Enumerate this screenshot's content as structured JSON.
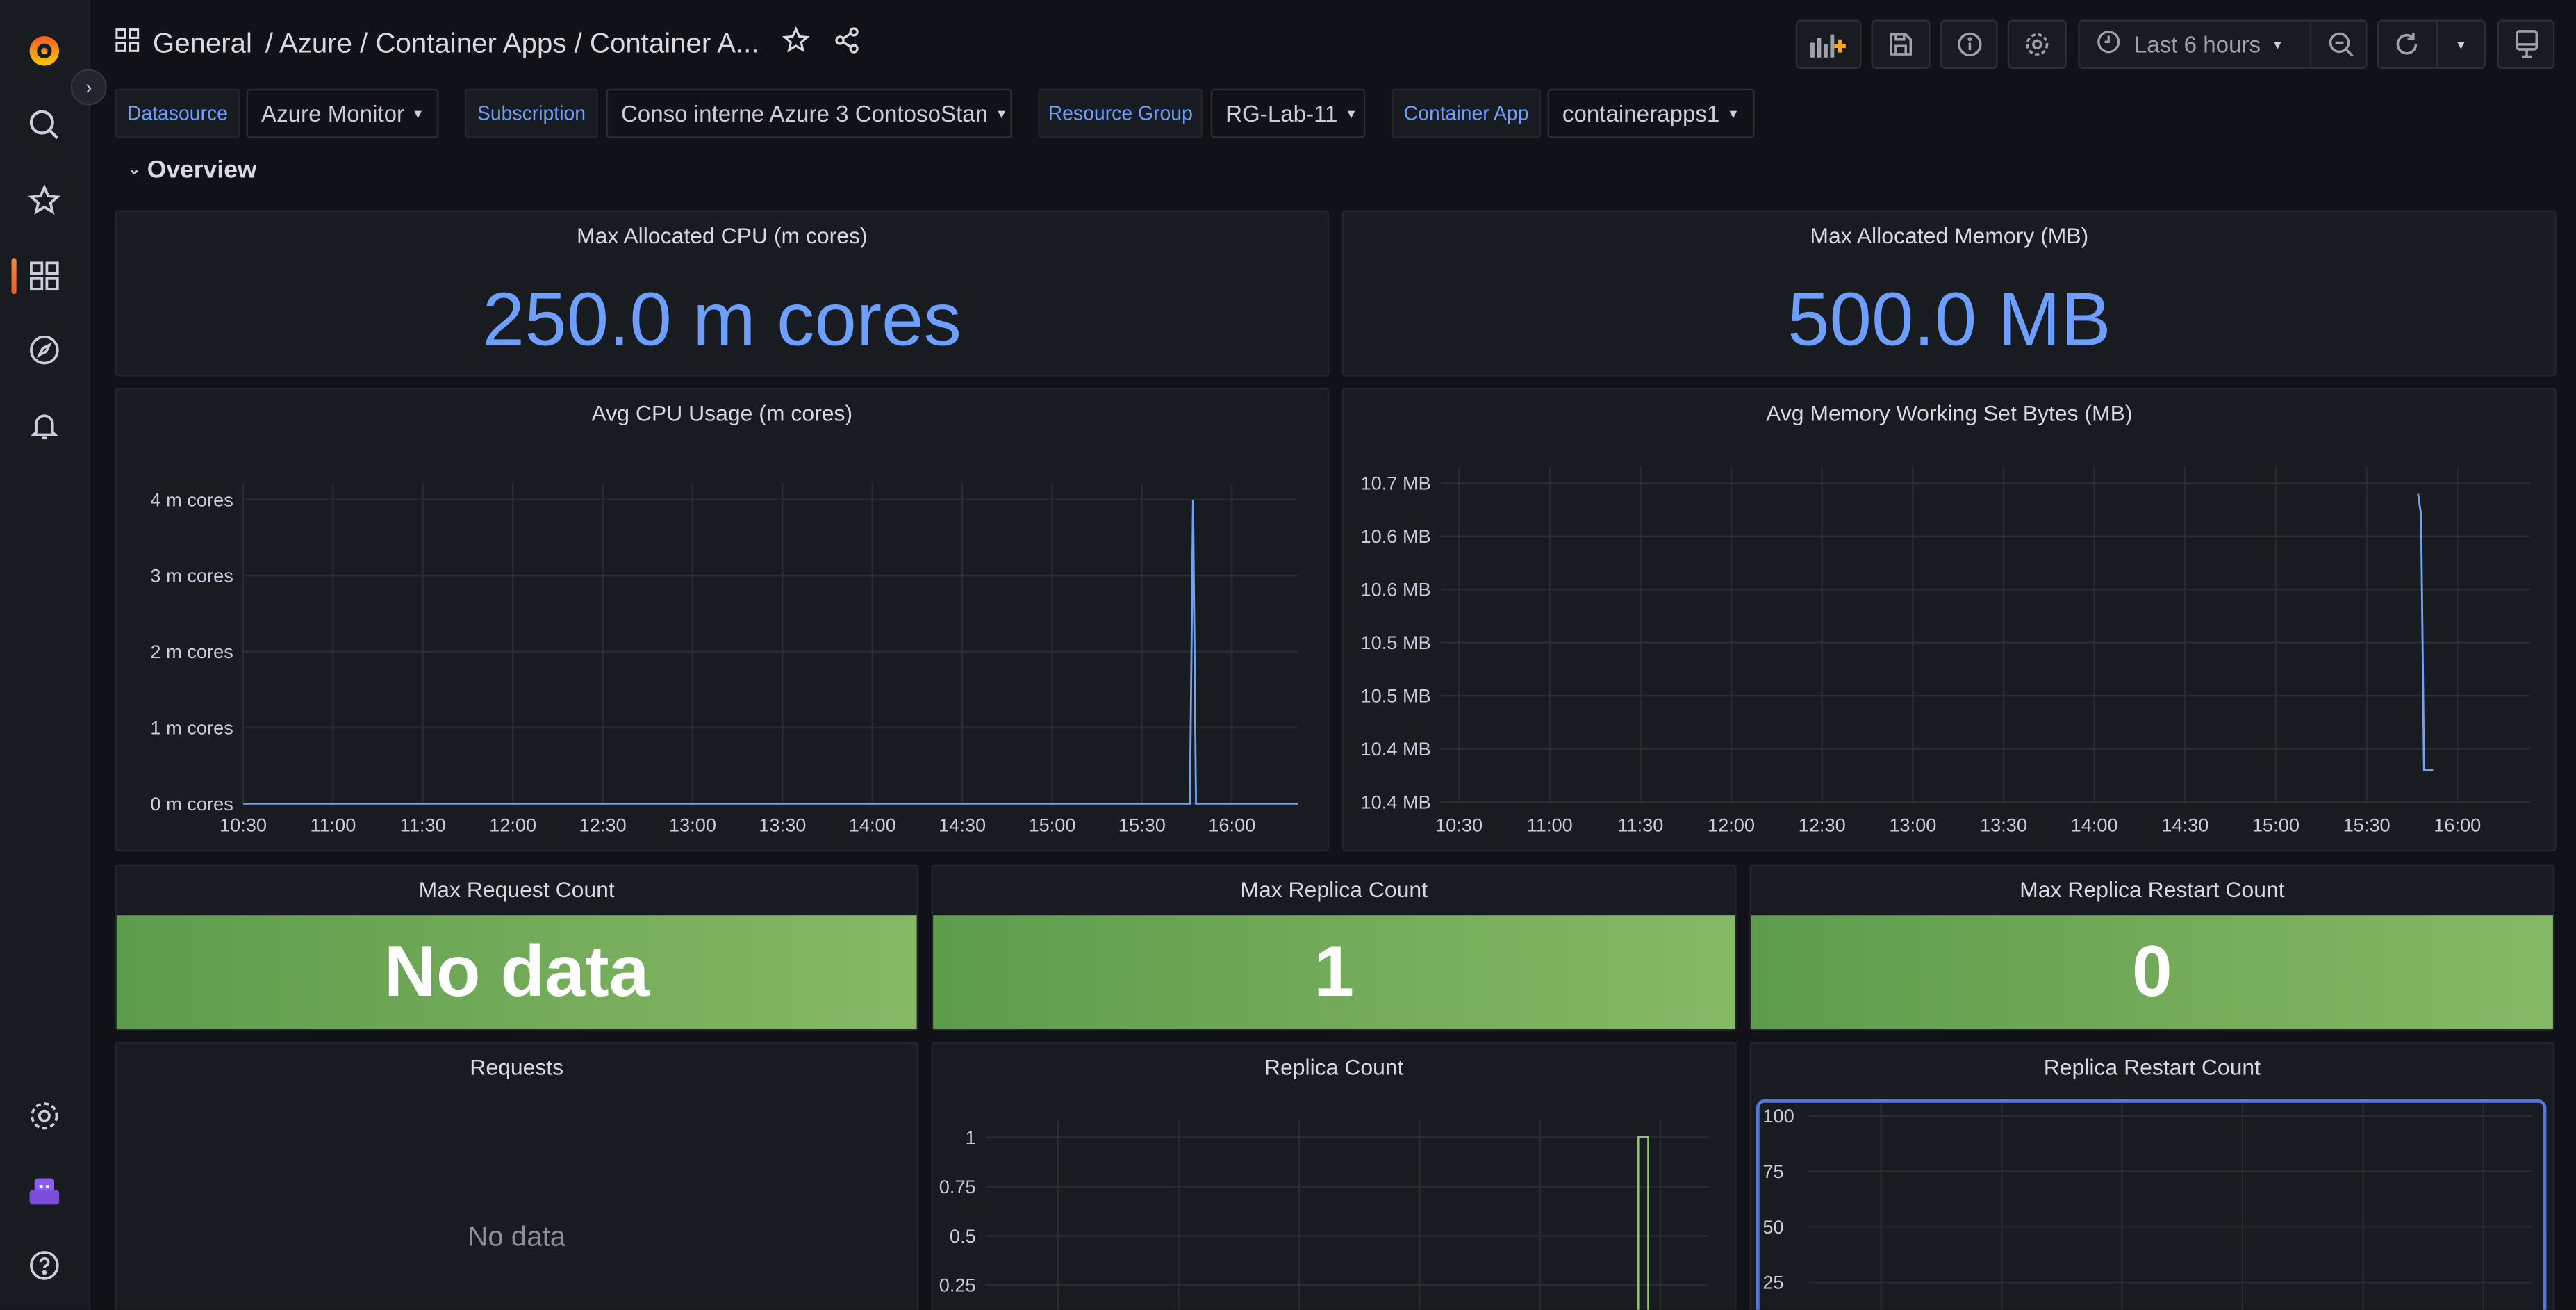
{
  "breadcrumb": {
    "root": "General",
    "path": "/ Azure / Container Apps / Container A..."
  },
  "toolbar": {
    "time_range": "Last 6 hours"
  },
  "variables": [
    {
      "label": "Datasource",
      "value": "Azure Monitor"
    },
    {
      "label": "Subscription",
      "value": "Conso interne Azure 3 ContosoStan"
    },
    {
      "label": "Resource Group",
      "value": "RG-Lab-11"
    },
    {
      "label": "Container App",
      "value": "containerapps1"
    }
  ],
  "row": {
    "title": "Overview"
  },
  "panels": {
    "max_cpu": {
      "title": "Max Allocated CPU (m cores)",
      "value": "250.0 m cores"
    },
    "max_mem": {
      "title": "Max Allocated Memory (MB)",
      "value": "500.0 MB"
    },
    "avg_cpu": {
      "title": "Avg CPU Usage (m cores)"
    },
    "avg_mem": {
      "title": "Avg Memory Working Set Bytes (MB)"
    },
    "max_requests": {
      "title": "Max Request Count",
      "value": "No data"
    },
    "max_replicas": {
      "title": "Max Replica Count",
      "value": "1"
    },
    "max_restarts": {
      "title": "Max Replica Restart Count",
      "value": "0"
    },
    "requests": {
      "title": "Requests",
      "value": "No data"
    },
    "replica_count": {
      "title": "Replica Count"
    },
    "replica_restart": {
      "title": "Replica Restart Count"
    }
  },
  "colors": {
    "accent": "#6e9fff",
    "stat_green": "#73b25a",
    "line_blue": "#73a1f2",
    "line_green": "#8ac766",
    "selected": "#5577dd"
  },
  "chart_data": [
    {
      "id": "avg_cpu",
      "type": "line",
      "title": "Avg CPU Usage (m cores)",
      "x_range": [
        "10:30",
        "16:22"
      ],
      "ylim": [
        0,
        4
      ],
      "x_ticks": [
        "10:30",
        "11:00",
        "11:30",
        "12:00",
        "12:30",
        "13:00",
        "13:30",
        "14:00",
        "14:30",
        "15:00",
        "15:30",
        "16:00"
      ],
      "y_ticks": [
        {
          "v": 0,
          "label": "0 m cores"
        },
        {
          "v": 1,
          "label": "1 m cores"
        },
        {
          "v": 2,
          "label": "2 m cores"
        },
        {
          "v": 3,
          "label": "3 m cores"
        },
        {
          "v": 4,
          "label": "4 m cores"
        }
      ],
      "series": [
        {
          "name": "Avg CPU",
          "color": "#73a1f2",
          "points": [
            [
              "10:30",
              0
            ],
            [
              "15:46",
              0
            ],
            [
              "15:47",
              4
            ],
            [
              "15:48",
              0
            ],
            [
              "16:22",
              0
            ]
          ]
        }
      ]
    },
    {
      "id": "avg_mem",
      "type": "line",
      "title": "Avg Memory Working Set Bytes (MB)",
      "x_range": [
        "10:24",
        "16:24"
      ],
      "ylim": [
        10.4,
        10.7
      ],
      "x_ticks": [
        "10:30",
        "11:00",
        "11:30",
        "12:00",
        "12:30",
        "13:00",
        "13:30",
        "14:00",
        "14:30",
        "15:00",
        "15:30",
        "16:00"
      ],
      "y_ticks": [
        {
          "v": 10.4,
          "label": "10.4 MB"
        },
        {
          "v": 10.45,
          "label": "10.4 MB"
        },
        {
          "v": 10.5,
          "label": "10.5 MB"
        },
        {
          "v": 10.55,
          "label": "10.5 MB"
        },
        {
          "v": 10.6,
          "label": "10.6 MB"
        },
        {
          "v": 10.65,
          "label": "10.6 MB"
        },
        {
          "v": 10.7,
          "label": "10.7 MB"
        }
      ],
      "series": [
        {
          "name": "Avg Memory",
          "color": "#73a1f2",
          "points": [
            [
              "15:47",
              10.69
            ],
            [
              "15:48",
              10.67
            ],
            [
              "15:49",
              10.43
            ],
            [
              "15:52",
              10.43
            ]
          ]
        }
      ]
    },
    {
      "id": "replica_count",
      "type": "line",
      "title": "Replica Count",
      "x_range": [
        "10:24",
        "16:24"
      ],
      "ylim": [
        0,
        1
      ],
      "x_ticks": [],
      "y_ticks": [
        {
          "v": 0.25,
          "label": "0.25"
        },
        {
          "v": 0.5,
          "label": "0.5"
        },
        {
          "v": 0.75,
          "label": "0.75"
        },
        {
          "v": 1,
          "label": "1"
        }
      ],
      "series": [
        {
          "name": "Replicas",
          "color": "#8ac766",
          "points": [
            [
              "15:49",
              0
            ],
            [
              "15:49",
              1
            ],
            [
              "15:54",
              1
            ],
            [
              "15:54",
              0
            ]
          ]
        }
      ]
    },
    {
      "id": "replica_restart",
      "type": "line",
      "title": "Replica Restart Count",
      "x_range": [
        "10:24",
        "16:24"
      ],
      "ylim": [
        0,
        100
      ],
      "x_ticks": [],
      "y_ticks": [
        {
          "v": 25,
          "label": "25"
        },
        {
          "v": 50,
          "label": "50"
        },
        {
          "v": 75,
          "label": "75"
        },
        {
          "v": 100,
          "label": "100"
        }
      ],
      "series": []
    }
  ]
}
